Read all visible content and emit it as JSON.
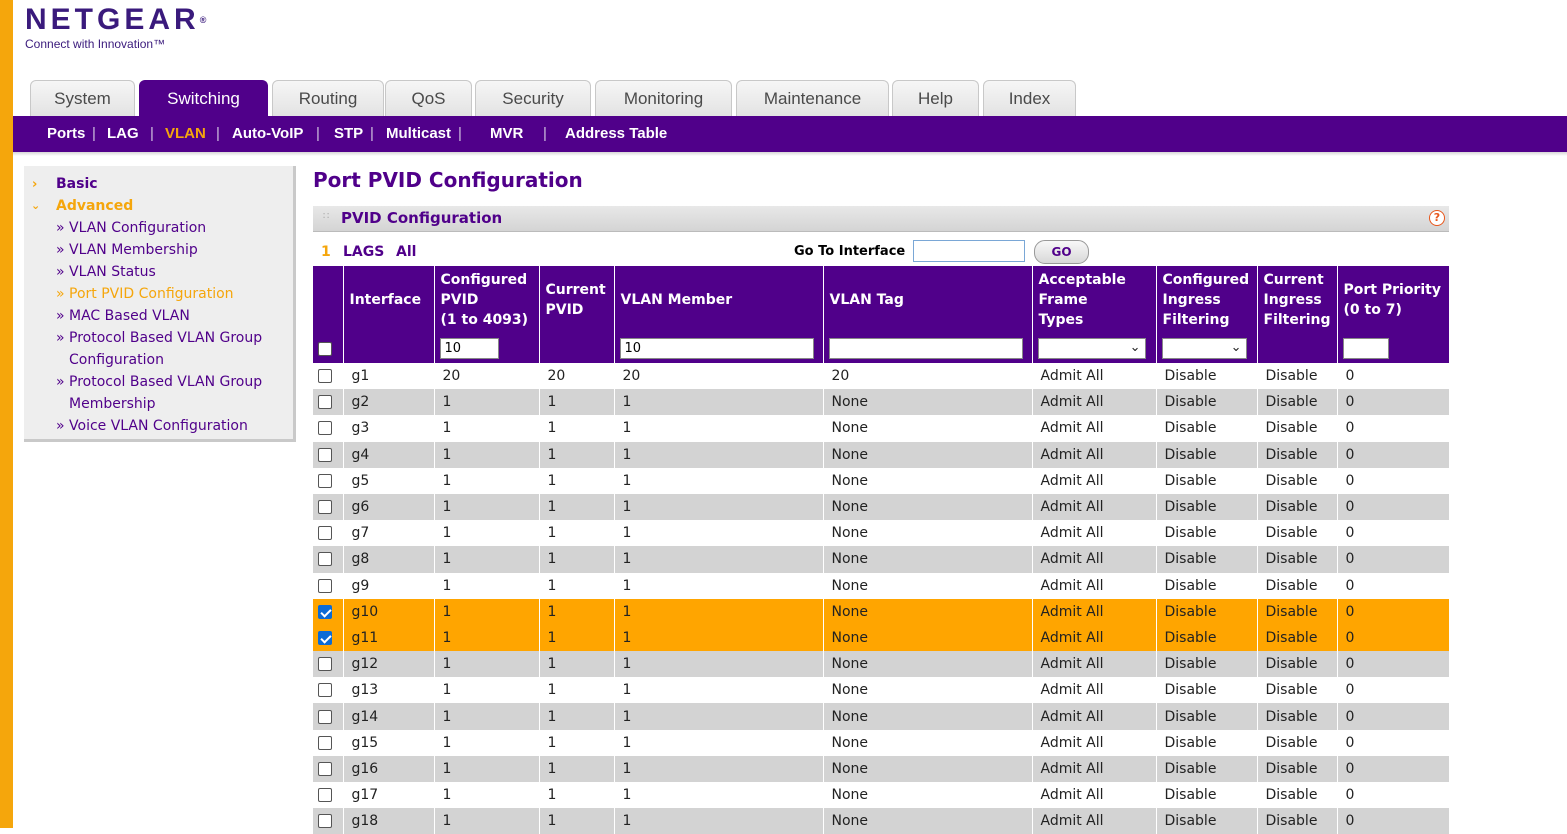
{
  "brand": {
    "name": "NETGEAR",
    "tagline": "Connect with Innovation™",
    "reg": "®"
  },
  "tabs": [
    {
      "label": "System",
      "active": false
    },
    {
      "label": "Switching",
      "active": true
    },
    {
      "label": "Routing",
      "active": false
    },
    {
      "label": "QoS",
      "active": false
    },
    {
      "label": "Security",
      "active": false
    },
    {
      "label": "Monitoring",
      "active": false
    },
    {
      "label": "Maintenance",
      "active": false
    },
    {
      "label": "Help",
      "active": false
    },
    {
      "label": "Index",
      "active": false
    }
  ],
  "subnav": [
    {
      "label": "Ports",
      "active": false
    },
    {
      "label": "LAG",
      "active": false
    },
    {
      "label": "VLAN",
      "active": true
    },
    {
      "label": "Auto-VoIP",
      "active": false
    },
    {
      "label": "STP",
      "active": false
    },
    {
      "label": "Multicast",
      "active": false
    },
    {
      "label": "MVR",
      "active": false
    },
    {
      "label": "Address Table",
      "active": false
    }
  ],
  "sidebar": {
    "basic": "Basic",
    "advanced": "Advanced",
    "items": [
      "» VLAN Configuration",
      "» VLAN Membership",
      "» VLAN Status",
      "» Port PVID Configuration",
      "» MAC Based VLAN",
      "» Protocol Based VLAN Group",
      "Configuration",
      "» Protocol Based VLAN Group",
      "Membership",
      "» Voice VLAN Configuration"
    ]
  },
  "page_title": "Port PVID Configuration",
  "section_title": "PVID Configuration",
  "help_icon": "?",
  "filter": {
    "unit": "1",
    "lags": "LAGS",
    "all": "All",
    "goto_label": "Go To Interface",
    "goto_value": "",
    "go_button": "GO"
  },
  "columns": [
    "",
    "Interface",
    "Configured\nPVID\n(1 to 4093)",
    "Current\nPVID",
    "VLAN Member",
    "VLAN Tag",
    "Acceptable\nFrame\nTypes",
    "Configured\nIngress\nFiltering",
    "Current\nIngress\nFiltering",
    "Port Priority\n(0 to 7)"
  ],
  "edit_row": {
    "pvid": "10",
    "vlan_member": "10",
    "vlan_tag": "",
    "frame_types": "",
    "ingress": "",
    "priority": ""
  },
  "rows": [
    {
      "checked": false,
      "interface": "g1",
      "cfg_pvid": "20",
      "cur_pvid": "20",
      "member": "20",
      "tag": "20",
      "frame": "Admit All",
      "cfg_ing": "Disable",
      "cur_ing": "Disable",
      "prio": "0"
    },
    {
      "checked": false,
      "interface": "g2",
      "cfg_pvid": "1",
      "cur_pvid": "1",
      "member": "1",
      "tag": "None",
      "frame": "Admit All",
      "cfg_ing": "Disable",
      "cur_ing": "Disable",
      "prio": "0"
    },
    {
      "checked": false,
      "interface": "g3",
      "cfg_pvid": "1",
      "cur_pvid": "1",
      "member": "1",
      "tag": "None",
      "frame": "Admit All",
      "cfg_ing": "Disable",
      "cur_ing": "Disable",
      "prio": "0"
    },
    {
      "checked": false,
      "interface": "g4",
      "cfg_pvid": "1",
      "cur_pvid": "1",
      "member": "1",
      "tag": "None",
      "frame": "Admit All",
      "cfg_ing": "Disable",
      "cur_ing": "Disable",
      "prio": "0"
    },
    {
      "checked": false,
      "interface": "g5",
      "cfg_pvid": "1",
      "cur_pvid": "1",
      "member": "1",
      "tag": "None",
      "frame": "Admit All",
      "cfg_ing": "Disable",
      "cur_ing": "Disable",
      "prio": "0"
    },
    {
      "checked": false,
      "interface": "g6",
      "cfg_pvid": "1",
      "cur_pvid": "1",
      "member": "1",
      "tag": "None",
      "frame": "Admit All",
      "cfg_ing": "Disable",
      "cur_ing": "Disable",
      "prio": "0"
    },
    {
      "checked": false,
      "interface": "g7",
      "cfg_pvid": "1",
      "cur_pvid": "1",
      "member": "1",
      "tag": "None",
      "frame": "Admit All",
      "cfg_ing": "Disable",
      "cur_ing": "Disable",
      "prio": "0"
    },
    {
      "checked": false,
      "interface": "g8",
      "cfg_pvid": "1",
      "cur_pvid": "1",
      "member": "1",
      "tag": "None",
      "frame": "Admit All",
      "cfg_ing": "Disable",
      "cur_ing": "Disable",
      "prio": "0"
    },
    {
      "checked": false,
      "interface": "g9",
      "cfg_pvid": "1",
      "cur_pvid": "1",
      "member": "1",
      "tag": "None",
      "frame": "Admit All",
      "cfg_ing": "Disable",
      "cur_ing": "Disable",
      "prio": "0"
    },
    {
      "checked": true,
      "interface": "g10",
      "cfg_pvid": "1",
      "cur_pvid": "1",
      "member": "1",
      "tag": "None",
      "frame": "Admit All",
      "cfg_ing": "Disable",
      "cur_ing": "Disable",
      "prio": "0"
    },
    {
      "checked": true,
      "interface": "g11",
      "cfg_pvid": "1",
      "cur_pvid": "1",
      "member": "1",
      "tag": "None",
      "frame": "Admit All",
      "cfg_ing": "Disable",
      "cur_ing": "Disable",
      "prio": "0"
    },
    {
      "checked": false,
      "interface": "g12",
      "cfg_pvid": "1",
      "cur_pvid": "1",
      "member": "1",
      "tag": "None",
      "frame": "Admit All",
      "cfg_ing": "Disable",
      "cur_ing": "Disable",
      "prio": "0"
    },
    {
      "checked": false,
      "interface": "g13",
      "cfg_pvid": "1",
      "cur_pvid": "1",
      "member": "1",
      "tag": "None",
      "frame": "Admit All",
      "cfg_ing": "Disable",
      "cur_ing": "Disable",
      "prio": "0"
    },
    {
      "checked": false,
      "interface": "g14",
      "cfg_pvid": "1",
      "cur_pvid": "1",
      "member": "1",
      "tag": "None",
      "frame": "Admit All",
      "cfg_ing": "Disable",
      "cur_ing": "Disable",
      "prio": "0"
    },
    {
      "checked": false,
      "interface": "g15",
      "cfg_pvid": "1",
      "cur_pvid": "1",
      "member": "1",
      "tag": "None",
      "frame": "Admit All",
      "cfg_ing": "Disable",
      "cur_ing": "Disable",
      "prio": "0"
    },
    {
      "checked": false,
      "interface": "g16",
      "cfg_pvid": "1",
      "cur_pvid": "1",
      "member": "1",
      "tag": "None",
      "frame": "Admit All",
      "cfg_ing": "Disable",
      "cur_ing": "Disable",
      "prio": "0"
    },
    {
      "checked": false,
      "interface": "g17",
      "cfg_pvid": "1",
      "cur_pvid": "1",
      "member": "1",
      "tag": "None",
      "frame": "Admit All",
      "cfg_ing": "Disable",
      "cur_ing": "Disable",
      "prio": "0"
    },
    {
      "checked": false,
      "interface": "g18",
      "cfg_pvid": "1",
      "cur_pvid": "1",
      "member": "1",
      "tag": "None",
      "frame": "Admit All",
      "cfg_ing": "Disable",
      "cur_ing": "Disable",
      "prio": "0"
    }
  ],
  "colors": {
    "brand_purple": "#50008a",
    "accent_orange": "#ffa500",
    "row_alt": "#d3d3d3"
  },
  "icons": {
    "section_grip": "grip-icon",
    "help": "help-icon",
    "sidebar_collapsed": "chevron-right-icon",
    "sidebar_expanded": "chevron-down-icon",
    "select_chevron": "chevron-down-icon"
  }
}
